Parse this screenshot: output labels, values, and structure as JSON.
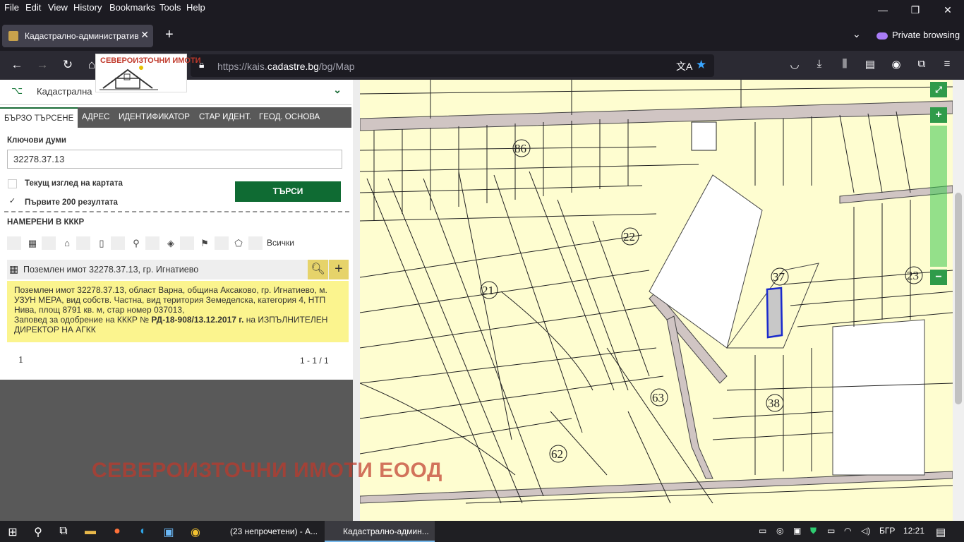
{
  "menu": [
    "File",
    "Edit",
    "View",
    "History",
    "Bookmarks",
    "Tools",
    "Help"
  ],
  "window_controls": {
    "minimize": "—",
    "restore": "❐",
    "close": "✕"
  },
  "browser_tab": {
    "title": "Кадастрално-административн",
    "close": "✕"
  },
  "new_tab": "+",
  "private_label": "Private browsing",
  "url": {
    "prefix": "https://kais.",
    "domain": "cadastre.bg",
    "path": "/bg/Map"
  },
  "logo_text": "СЕВЕРОИЗТОЧНИ ИМОТИ",
  "panel": {
    "header": "Кадастрална",
    "tabs": [
      "БЪРЗО ТЪРСЕНЕ",
      "АДРЕС",
      "ИДЕНТИФИКАТОР",
      "СТАР ИДЕНТ.",
      "ГЕОД. ОСНОВА"
    ],
    "keywords_label": "Ключови думи",
    "keywords_value": "32278.37.13",
    "checkbox_view": "Текущ изглед на картата",
    "checkbox_first": "Първите 200 резултата",
    "search_button": "ТЪРСИ",
    "found_label": "НАМЕРЕНИ В КККР",
    "all_label": "Всички",
    "result_title": "Поземлен имот 32278.37.13, гр. Игнатиево",
    "info_line1": "Поземлен имот 32278.37.13, област Варна, община Аксаково, гр. Игнатиево, м.",
    "info_line2": "УЗУН МЕРА, вид собств. Частна, вид територия Земеделска, категория 4, НТП",
    "info_line3": "Нива, площ 8791 кв. м, стар номер 037013,",
    "info_line4_pre": "Заповед за одобрение на КККР № ",
    "info_line4_bold": "РД-18-908/13.12.2017 г.",
    "info_line4_post": " на ИЗПЪЛНИТЕЛЕН",
    "info_line5": "ДИРЕКТОР НА АГКК",
    "page": "1",
    "count": "1 - 1 / 1"
  },
  "watermark": "СЕВЕРОИЗТОЧНИ ИМОТИ ЕООД",
  "map": {
    "labels": [
      "86",
      "22",
      "21",
      "37",
      "23",
      "63",
      "38",
      "62"
    ],
    "zoom_in": "+",
    "zoom_out": "−"
  },
  "taskbar": {
    "apps": [
      "(23 непрочетени) - А...",
      "Кадастрално-админ..."
    ],
    "lang": "БГР",
    "time": "12:21"
  }
}
